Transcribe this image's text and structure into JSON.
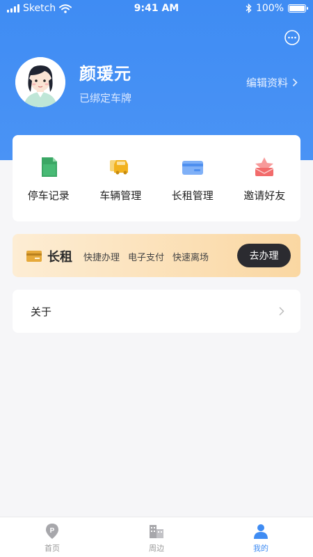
{
  "status_bar": {
    "carrier": "Sketch",
    "time": "9:41 AM",
    "battery": "100%"
  },
  "profile": {
    "name": "颜瑗元",
    "plate_status": "已绑定车牌",
    "edit_label": "编辑资料"
  },
  "menu": {
    "items": [
      {
        "label": "停车记录",
        "icon": "parking-record-icon"
      },
      {
        "label": "车辆管理",
        "icon": "car-management-icon"
      },
      {
        "label": "长租管理",
        "icon": "long-rent-card-icon"
      },
      {
        "label": "邀请好友",
        "icon": "invite-friend-icon"
      }
    ]
  },
  "banner": {
    "title": "长租",
    "tags": [
      "快捷办理",
      "电子支付",
      "快速离场"
    ],
    "button": "去办理"
  },
  "about": {
    "label": "关于"
  },
  "tabbar": {
    "items": [
      {
        "label": "首页",
        "icon": "parking-pin-icon",
        "active": false
      },
      {
        "label": "周边",
        "icon": "building-icon",
        "active": false
      },
      {
        "label": "我的",
        "icon": "user-icon",
        "active": true
      }
    ]
  },
  "colors": {
    "primary": "#3f8cf3",
    "banner_button": "#2b2b30"
  }
}
